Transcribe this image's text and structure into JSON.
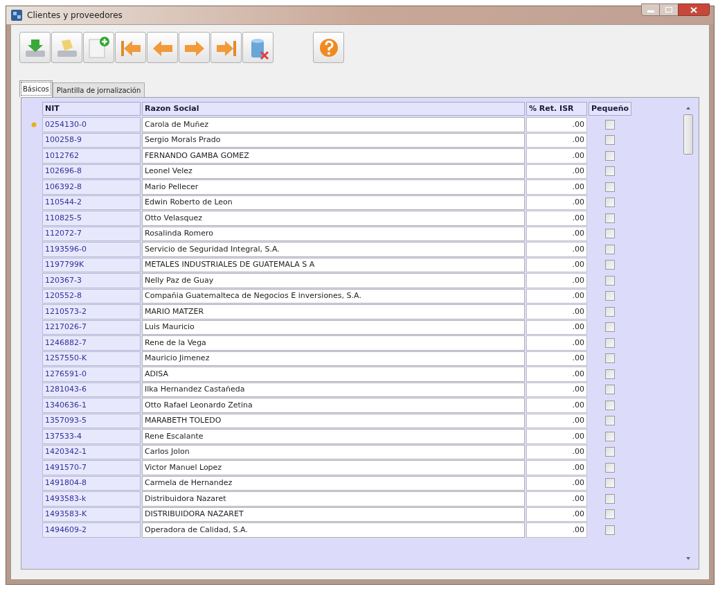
{
  "window": {
    "title": "Clientes y proveedores"
  },
  "toolbar": [
    {
      "kind": "save"
    },
    {
      "kind": "edit"
    },
    {
      "kind": "new"
    },
    {
      "kind": "first"
    },
    {
      "kind": "previous"
    },
    {
      "kind": "next"
    },
    {
      "kind": "last"
    },
    {
      "kind": "delete"
    },
    {
      "kind": "help"
    }
  ],
  "tabs": [
    {
      "label": "Básicos",
      "selected": true
    },
    {
      "label": "Plantilla de jornalización",
      "selected": false
    }
  ],
  "table": {
    "columns": [
      "NIT",
      "Razon Social",
      "% Ret. ISR",
      "Pequeño"
    ],
    "rows": [
      {
        "nit": "0254130-0",
        "razon_social": "Carola de Muñez",
        "ret_isr": ".00",
        "pequeno": false,
        "current": true
      },
      {
        "nit": "100258-9",
        "razon_social": "Sergio Morals Prado",
        "ret_isr": ".00",
        "pequeno": false,
        "current": false
      },
      {
        "nit": "1012762",
        "razon_social": "FERNANDO GAMBA GOMEZ",
        "ret_isr": ".00",
        "pequeno": false,
        "current": false
      },
      {
        "nit": "102696-8",
        "razon_social": "Leonel Velez",
        "ret_isr": ".00",
        "pequeno": false,
        "current": false
      },
      {
        "nit": "106392-8",
        "razon_social": "Mario Pellecer",
        "ret_isr": ".00",
        "pequeno": false,
        "current": false
      },
      {
        "nit": "110544-2",
        "razon_social": "Edwin Roberto de Leon",
        "ret_isr": ".00",
        "pequeno": false,
        "current": false
      },
      {
        "nit": "110825-5",
        "razon_social": "Otto Velasquez",
        "ret_isr": ".00",
        "pequeno": false,
        "current": false
      },
      {
        "nit": "112072-7",
        "razon_social": "Rosalinda Romero",
        "ret_isr": ".00",
        "pequeno": false,
        "current": false
      },
      {
        "nit": "1193596-0",
        "razon_social": "Servicio de Seguridad Integral, S.A.",
        "ret_isr": ".00",
        "pequeno": false,
        "current": false
      },
      {
        "nit": "1197799K",
        "razon_social": "METALES INDUSTRIALES DE GUATEMALA S A",
        "ret_isr": ".00",
        "pequeno": false,
        "current": false
      },
      {
        "nit": "120367-3",
        "razon_social": "Nelly Paz de Guay",
        "ret_isr": ".00",
        "pequeno": false,
        "current": false
      },
      {
        "nit": "120552-8",
        "razon_social": "Compañia Guatemalteca de Negocios E inversiones, S.A.",
        "ret_isr": ".00",
        "pequeno": false,
        "current": false
      },
      {
        "nit": "1210573-2",
        "razon_social": "MARIO MATZER",
        "ret_isr": ".00",
        "pequeno": false,
        "current": false
      },
      {
        "nit": "1217026-7",
        "razon_social": "Luis Mauricio",
        "ret_isr": ".00",
        "pequeno": false,
        "current": false
      },
      {
        "nit": "1246882-7",
        "razon_social": "Rene de la Vega",
        "ret_isr": ".00",
        "pequeno": false,
        "current": false
      },
      {
        "nit": "1257550-K",
        "razon_social": "Mauricio Jimenez",
        "ret_isr": ".00",
        "pequeno": false,
        "current": false
      },
      {
        "nit": "1276591-0",
        "razon_social": "ADISA",
        "ret_isr": ".00",
        "pequeno": false,
        "current": false
      },
      {
        "nit": "1281043-6",
        "razon_social": "Ilka Hernandez Castañeda",
        "ret_isr": ".00",
        "pequeno": false,
        "current": false
      },
      {
        "nit": "1340636-1",
        "razon_social": "Otto Rafael Leonardo Zetina",
        "ret_isr": ".00",
        "pequeno": false,
        "current": false
      },
      {
        "nit": "1357093-5",
        "razon_social": "MARABETH TOLEDO",
        "ret_isr": ".00",
        "pequeno": false,
        "current": false
      },
      {
        "nit": "137533-4",
        "razon_social": "Rene Escalante",
        "ret_isr": ".00",
        "pequeno": false,
        "current": false
      },
      {
        "nit": "1420342-1",
        "razon_social": "Carlos Jolon",
        "ret_isr": ".00",
        "pequeno": false,
        "current": false
      },
      {
        "nit": "1491570-7",
        "razon_social": "Victor Manuel Lopez",
        "ret_isr": ".00",
        "pequeno": false,
        "current": false
      },
      {
        "nit": "1491804-8",
        "razon_social": "Carmela de Hernandez",
        "ret_isr": ".00",
        "pequeno": false,
        "current": false
      },
      {
        "nit": "1493583-k",
        "razon_social": "Distribuidora Nazaret",
        "ret_isr": ".00",
        "pequeno": false,
        "current": false
      },
      {
        "nit": "1493583-K",
        "razon_social": "DISTRIBUIDORA NAZARET",
        "ret_isr": ".00",
        "pequeno": false,
        "current": false
      },
      {
        "nit": "1494609-2",
        "razon_social": "Operadora de Calidad, S.A.",
        "ret_isr": ".00",
        "pequeno": false,
        "current": false
      }
    ]
  }
}
